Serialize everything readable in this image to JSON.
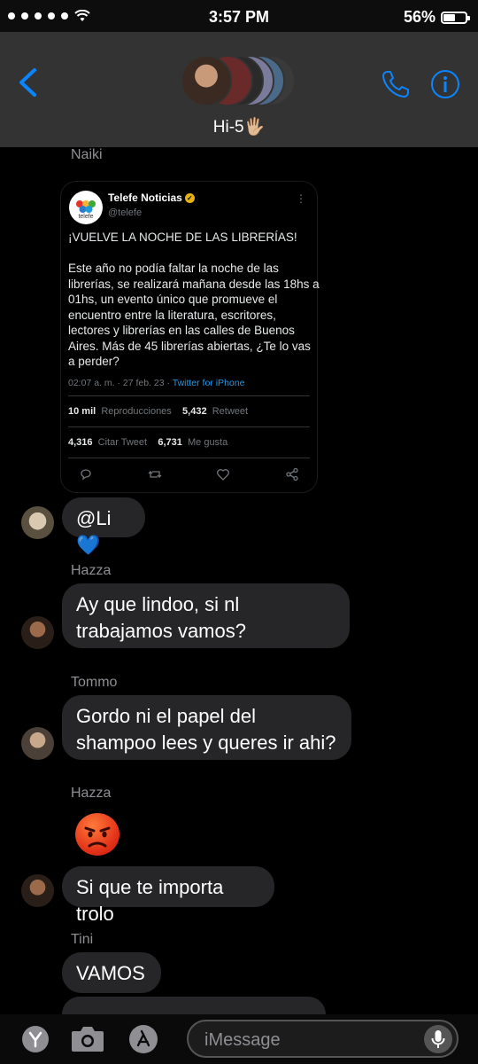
{
  "status_bar": {
    "time": "3:57 PM",
    "battery": "56%",
    "battery_level": 0.56
  },
  "header": {
    "title": "Hi-5🖐🏼"
  },
  "colors": {
    "accent": "#0a84ff",
    "bubble": "#262628",
    "header_bg": "#333333"
  },
  "messages": [
    {
      "sender": "Naiki"
    },
    {
      "text": "@Li💙"
    },
    {
      "sender": "Hazza"
    },
    {
      "text": "Ay que lindoo, si nl trabajamos vamos?"
    },
    {
      "sender": "Tommo"
    },
    {
      "text": "Gordo ni el papel del shampoo lees y queres ir ahi?"
    },
    {
      "sender": "Hazza"
    },
    {
      "text": "Si que te importa trolo"
    },
    {
      "sender": "Tini"
    },
    {
      "text": "VAMOS"
    }
  ],
  "tweet": {
    "name": "Telefe Noticias",
    "handle": "@telefe",
    "logo_text": "telefe",
    "text": "¡VUELVE LA NOCHE DE LAS LIBRERÍAS!\n\nEste año no podía faltar la noche de las librerías, se realizará mañana desde las 18hs a 01hs, un evento único que promueve el encuentro entre la literatura, escritores, lectores y librerías en las calles de Buenos Aires. Más de 45 librerías abiertas, ¿Te lo vas a perder?",
    "timestamp": "02:07 a. m. · 27 feb. 23 · ",
    "source": "Twitter for iPhone",
    "views_count": "10 mil",
    "views_label": "Reproducciones",
    "retweets_count": "5,432",
    "retweets_label": "Retweet",
    "quotes_count": "4,316",
    "quotes_label": "Citar Tweet",
    "likes_count": "6,731",
    "likes_label": "Me gusta"
  },
  "input": {
    "placeholder": "iMessage"
  }
}
